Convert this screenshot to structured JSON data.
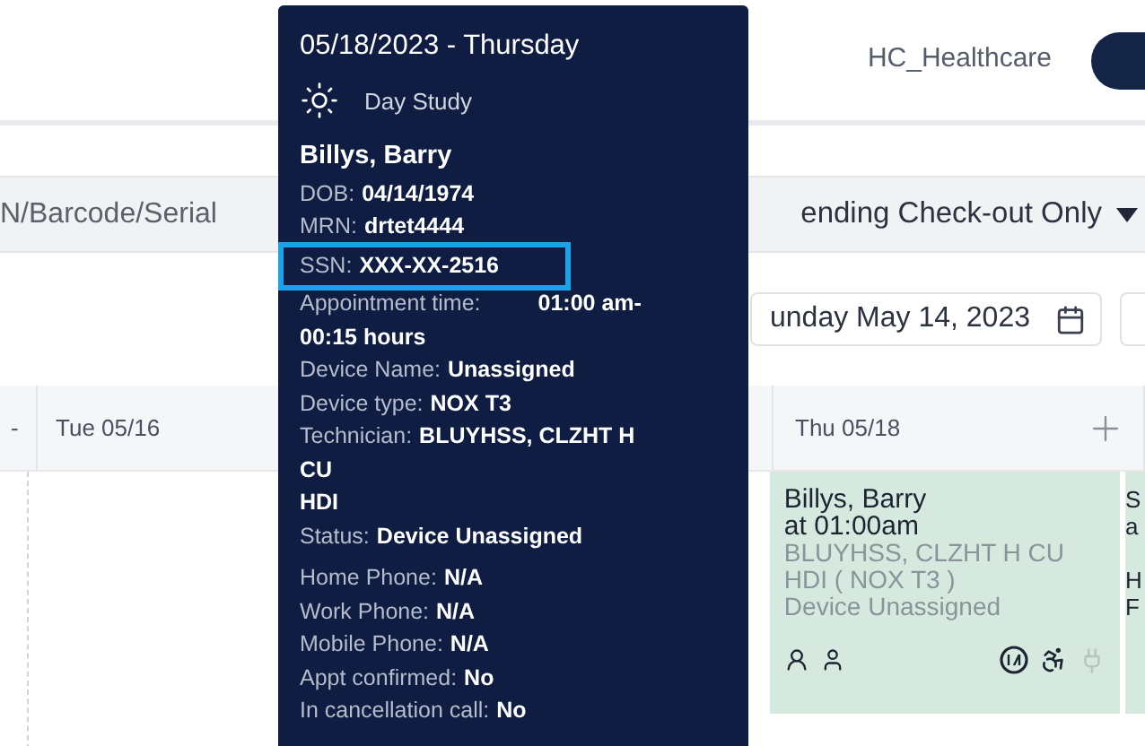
{
  "header": {
    "account": "HC_Healthcare"
  },
  "filters": {
    "search_text": "N/Barcode/Serial",
    "status_filter": "ending Check-out Only",
    "date": "unday May 14, 2023"
  },
  "calendar": {
    "columns": [
      {
        "label": "-",
        "add": false
      },
      {
        "label": "Tue 05/16",
        "add": false
      },
      {
        "label": "Thu 05/18",
        "add": true
      }
    ],
    "appointment": {
      "lines": [
        "Billys, Barry",
        "at 01:00am",
        "BLUYHSS, CLZHT H CU",
        "HDI ( NOX T3 )",
        "Device Unassigned"
      ],
      "color": "#d5e9df"
    },
    "next_card_letters": [
      "S",
      "a",
      "H",
      "F"
    ]
  },
  "tooltip": {
    "date": "05/18/2023 - Thursday",
    "study": "Day Study",
    "patient": "Billys, Barry",
    "groups": [
      [
        {
          "label": "DOB:",
          "value": "04/14/1974",
          "highlighted": false
        },
        {
          "label": "MRN:",
          "value": "drtet4444",
          "highlighted": false
        },
        {
          "label": "SSN:",
          "value": "XXX-XX-2516",
          "highlighted": true
        },
        {
          "label": "Appointment time:",
          "value": "01:00 am-",
          "highlighted": false
        },
        {
          "value": "00:15 hours",
          "highlighted": false
        },
        {
          "label": "Device Name:",
          "value": "Unassigned",
          "highlighted": false
        },
        {
          "label": "Device type:",
          "value": "NOX T3",
          "highlighted": false
        },
        {
          "label": "Technician:",
          "value": "BLUYHSS, CLZHT H",
          "highlighted": false
        },
        {
          "value": "CU",
          "highlighted": false
        },
        {
          "value": "HDI",
          "highlighted": false
        },
        {
          "label": "Status:",
          "value": "Device Unassigned",
          "highlighted": false
        }
      ],
      [
        {
          "label": "Home Phone:",
          "value": "N/A",
          "highlighted": false
        },
        {
          "label": "Work Phone:",
          "value": "N/A",
          "highlighted": false
        },
        {
          "label": "Mobile Phone:",
          "value": "N/A",
          "highlighted": false
        },
        {
          "label": "Appt confirmed:",
          "value": "No",
          "highlighted": false
        },
        {
          "label": "In cancellation call:",
          "value": "No",
          "highlighted": false
        }
      ]
    ]
  }
}
